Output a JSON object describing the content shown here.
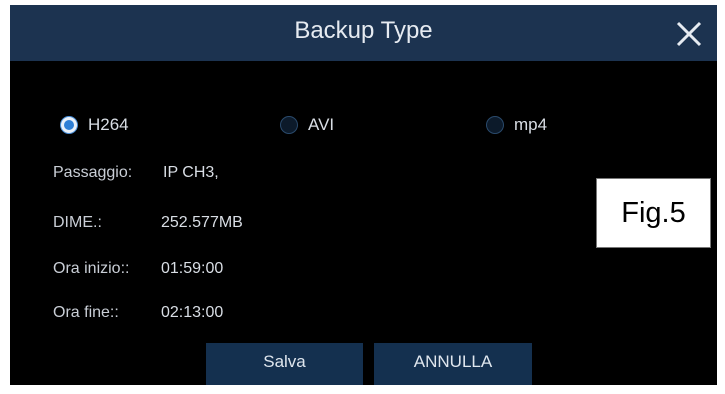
{
  "dialog": {
    "title": "Backup Type",
    "close_icon": "close-x-icon"
  },
  "formats": [
    {
      "label": "H264",
      "selected": true
    },
    {
      "label": "AVI",
      "selected": false
    },
    {
      "label": "mp4",
      "selected": false
    }
  ],
  "info": {
    "passaggio_label": "Passaggio:",
    "passaggio_value": "IP CH3,",
    "dime_label": "DIME.:",
    "dime_value": "252.577MB",
    "start_label": "Ora inizio::",
    "start_value": "01:59:00",
    "end_label": "Ora fine::",
    "end_value": "02:13:00"
  },
  "buttons": {
    "save_label": "Salva",
    "cancel_label": "ANNULLA"
  },
  "figure_label": "Fig.5",
  "colors": {
    "titlebar": "#1c3350",
    "background": "#000000",
    "button": "#14304f",
    "radio_selected": "#2e7fd6"
  }
}
